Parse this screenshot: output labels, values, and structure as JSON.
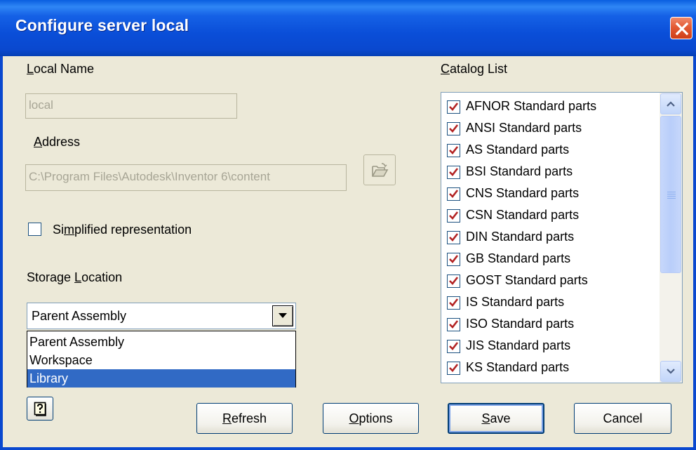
{
  "window": {
    "title": "Configure server local"
  },
  "local_name": {
    "label_pre": "",
    "label_mnemonic": "L",
    "label_post": "ocal Name",
    "value": "local"
  },
  "address": {
    "label_pre": "",
    "label_mnemonic": "A",
    "label_post": "ddress",
    "value": "C:\\Program Files\\Autodesk\\Inventor 6\\content"
  },
  "simplified": {
    "label_pre": "Si",
    "label_mnemonic": "m",
    "label_post": "plified representation",
    "checked": false
  },
  "storage": {
    "label_pre": "Storage ",
    "label_mnemonic": "L",
    "label_post": "ocation",
    "selected": "Parent Assembly",
    "options": [
      "Parent Assembly",
      "Workspace",
      "Library"
    ],
    "highlighted_index": 2
  },
  "catalog": {
    "label_pre": "",
    "label_mnemonic": "C",
    "label_post": "atalog List",
    "items": [
      {
        "label": "AFNOR Standard parts",
        "checked": true
      },
      {
        "label": "ANSI Standard parts",
        "checked": true
      },
      {
        "label": "AS Standard parts",
        "checked": true
      },
      {
        "label": "BSI Standard parts",
        "checked": true
      },
      {
        "label": "CNS Standard parts",
        "checked": true
      },
      {
        "label": "CSN Standard parts",
        "checked": true
      },
      {
        "label": "DIN Standard parts",
        "checked": true
      },
      {
        "label": "GB Standard parts",
        "checked": true
      },
      {
        "label": "GOST Standard parts",
        "checked": true
      },
      {
        "label": "IS Standard parts",
        "checked": true
      },
      {
        "label": "ISO Standard parts",
        "checked": true
      },
      {
        "label": "JIS Standard parts",
        "checked": true
      },
      {
        "label": "KS Standard parts",
        "checked": true
      }
    ]
  },
  "buttons": {
    "refresh": {
      "pre": "",
      "mnemonic": "R",
      "post": "efresh"
    },
    "options": {
      "pre": "",
      "mnemonic": "O",
      "post": "ptions"
    },
    "save": {
      "pre": "",
      "mnemonic": "S",
      "post": "ave"
    },
    "cancel": {
      "pre": "Cancel",
      "mnemonic": "",
      "post": ""
    }
  },
  "icons": {
    "close": "close-icon",
    "browse": "folder-open-icon",
    "help": "help-icon",
    "dropdown": "chevron-down-icon",
    "scroll_up": "scroll-up-icon",
    "scroll_down": "scroll-down-icon",
    "check": "checkmark-icon"
  },
  "colors": {
    "titlebar": "#0a48cf",
    "dialog_bg": "#ece9d8",
    "selection": "#316ac5",
    "check_mark": "#b22222",
    "close_button": "#e35a33"
  }
}
